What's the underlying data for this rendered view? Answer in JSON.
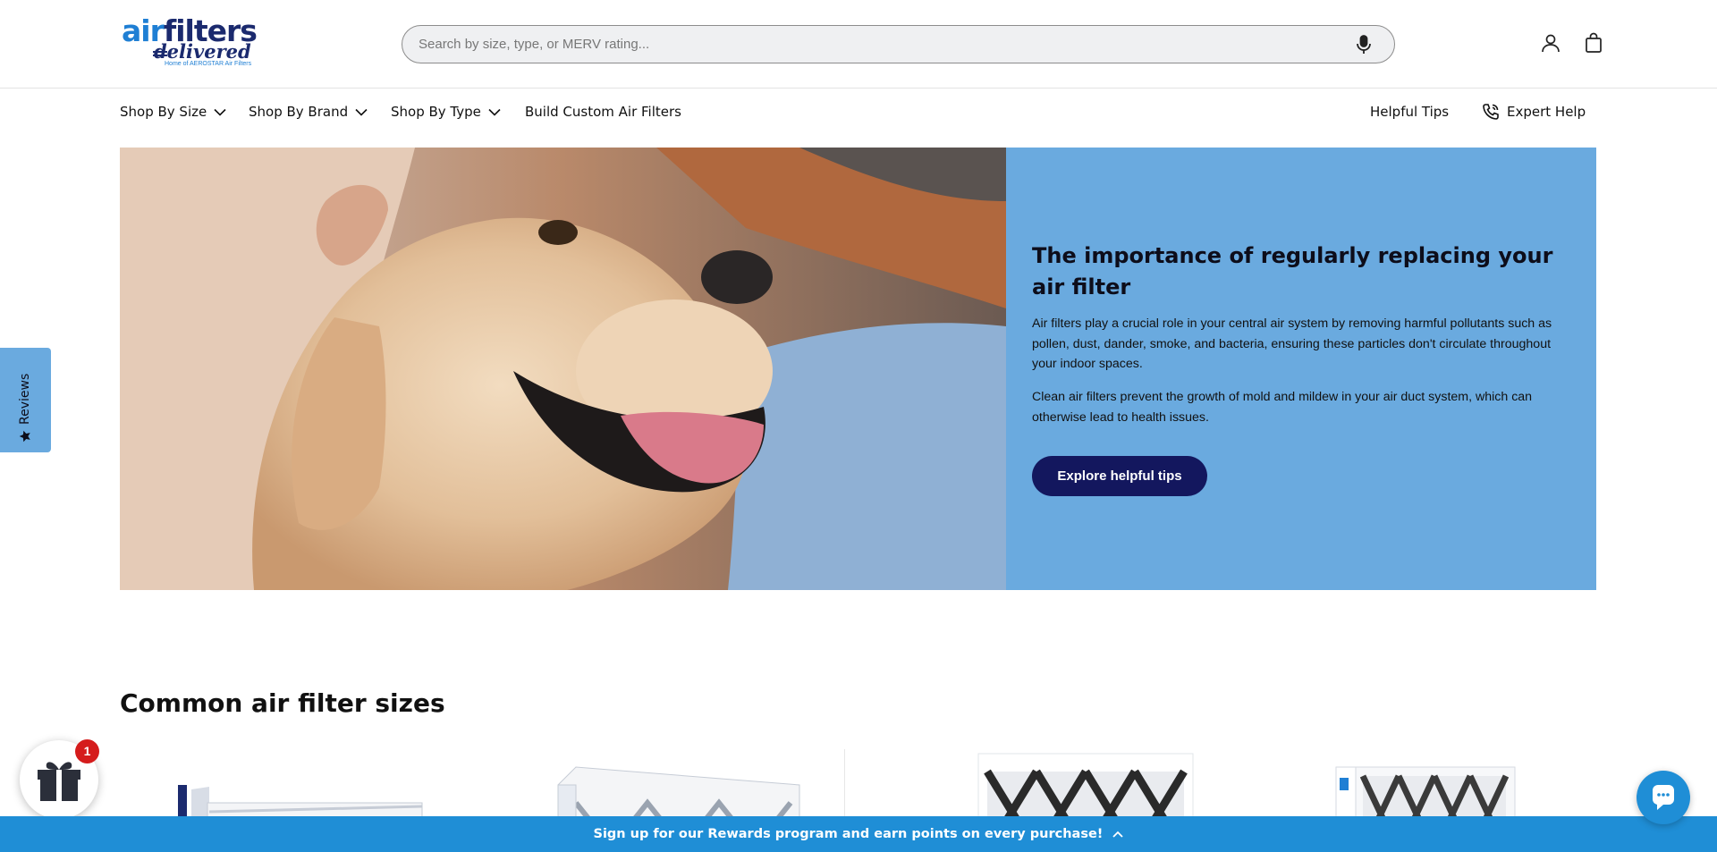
{
  "logo": {
    "line1_air": "air",
    "line1_filters": "filters",
    "line2": "delivered",
    "tagline": "Home of AEROSTAR Air Filters"
  },
  "search": {
    "placeholder": "Search by size, type, or MERV rating..."
  },
  "icons": {
    "mic": "microphone-icon",
    "account": "user-icon",
    "cart": "shopping-bag-icon",
    "phone": "phone-icon",
    "star": "star-icon",
    "gift": "gift-icon",
    "chat": "chat-icon"
  },
  "nav": {
    "left": [
      {
        "label": "Shop By Size",
        "dropdown": true
      },
      {
        "label": "Shop By Brand",
        "dropdown": true
      },
      {
        "label": "Shop By Type",
        "dropdown": true
      },
      {
        "label": "Build Custom Air Filters",
        "dropdown": false
      }
    ],
    "helpful_tips": "Helpful Tips",
    "expert_help": "Expert Help"
  },
  "hero": {
    "title": "The importance of regularly replacing your air filter",
    "p1": "Air filters play a crucial role in your central air system by removing harmful pollutants such as pollen, dust, dander, smoke, and bacteria, ensuring these particles don't circulate throughout your indoor spaces.",
    "p2": "Clean air filters prevent the growth of mold and mildew in your air duct system, which can otherwise lead to health issues.",
    "button": "Explore helpful tips",
    "panel_color": "#6aaadf",
    "button_color": "#13175e"
  },
  "reviews_tab": {
    "label": "Reviews"
  },
  "section": {
    "title": "Common air filter sizes"
  },
  "gift": {
    "badge_count": "1"
  },
  "rewards_bar": {
    "text": "Sign up for our Rewards program and earn points on every purchase!",
    "color": "#1f8ed6"
  }
}
